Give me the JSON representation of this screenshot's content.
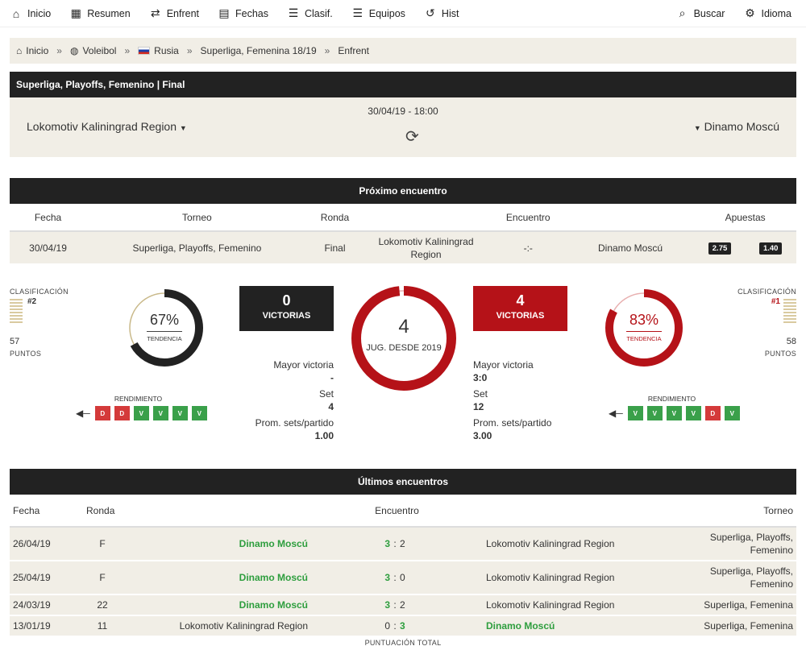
{
  "nav": {
    "items": [
      {
        "icon": "home-icon",
        "glyph": "⌂",
        "label": "Inicio"
      },
      {
        "icon": "dashboard-icon",
        "glyph": "▦",
        "label": "Resumen"
      },
      {
        "icon": "versus-icon",
        "glyph": "⇄",
        "label": "Enfrent"
      },
      {
        "icon": "calendar-icon",
        "glyph": "▤",
        "label": "Fechas"
      },
      {
        "icon": "list-icon",
        "glyph": "☰",
        "label": "Clasif."
      },
      {
        "icon": "list-icon",
        "glyph": "☰",
        "label": "Equipos"
      },
      {
        "icon": "history-icon",
        "glyph": "↺",
        "label": "Hist"
      }
    ],
    "search": "Buscar",
    "language": "Idioma"
  },
  "breadcrumb": [
    "Inicio",
    "Voleibol",
    "Rusia",
    "Superliga, Femenina 18/19",
    "Enfrent"
  ],
  "match": {
    "header": "Superliga, Playoffs, Femenino | Final",
    "datetime": "30/04/19 - 18:00",
    "home": "Lokomotiv Kaliningrad Region",
    "away": "Dinamo Moscú"
  },
  "next": {
    "title": "Próximo encuentro",
    "cols": [
      "Fecha",
      "Torneo",
      "Ronda",
      "Encuentro",
      "Apuestas"
    ],
    "row": {
      "date": "30/04/19",
      "tournament": "Superliga, Playoffs, Femenino",
      "round": "Final",
      "home": "Lokomotiv Kaliningrad Region",
      "score": "-:-",
      "away": "Dinamo Moscú",
      "odd1": "2.75",
      "odd2": "1.40"
    }
  },
  "stats": {
    "clas_label": "CLASIFICACIÓN",
    "points_label": "PUNTOS",
    "home": {
      "rank": "#2",
      "points": "57",
      "pct": "67%",
      "pct_value": 0.67,
      "wins": "0",
      "mayor": "-",
      "sets": "4",
      "prom": "1.00",
      "form": [
        "D",
        "D",
        "V",
        "V",
        "V",
        "V"
      ]
    },
    "away": {
      "rank": "#1",
      "points": "58",
      "pct": "83%",
      "pct_value": 0.83,
      "wins": "4",
      "mayor": "3:0",
      "sets": "12",
      "prom": "3.00",
      "form": [
        "V",
        "V",
        "V",
        "V",
        "D",
        "V"
      ]
    },
    "tendencia": "TENDENCIA",
    "victorias": "VICTORIAS",
    "rendimiento": "RENDIMIENTO",
    "games": "4",
    "games_label": "JUG. DESDE 2019",
    "mayor_label": "Mayor victoria",
    "sets_label": "Set",
    "prom_label": "Prom. sets/partido",
    "colors": {
      "dark": "#222222",
      "red": "#b51218",
      "win": "#3aa04a",
      "loss": "#d43a3a"
    }
  },
  "last": {
    "title": "Últimos encuentros",
    "cols": [
      "Fecha",
      "Ronda",
      "Encuentro",
      "Torneo"
    ],
    "rows": [
      {
        "date": "26/04/19",
        "round": "F",
        "home": "Dinamo Moscú",
        "hs": "3",
        "as": "2",
        "away": "Lokomotiv Kaliningrad Region",
        "tournament": "Superliga, Playoffs, Femenino",
        "homewin": true
      },
      {
        "date": "25/04/19",
        "round": "F",
        "home": "Dinamo Moscú",
        "hs": "3",
        "as": "0",
        "away": "Lokomotiv Kaliningrad Region",
        "tournament": "Superliga, Playoffs, Femenino",
        "homewin": true
      },
      {
        "date": "24/03/19",
        "round": "22",
        "home": "Dinamo Moscú",
        "hs": "3",
        "as": "2",
        "away": "Lokomotiv Kaliningrad Region",
        "tournament": "Superliga, Femenina",
        "homewin": true
      },
      {
        "date": "13/01/19",
        "round": "11",
        "home": "Lokomotiv Kaliningrad Region",
        "hs": "0",
        "as": "3",
        "away": "Dinamo Moscú",
        "tournament": "Superliga, Femenina",
        "homewin": false
      }
    ],
    "footer": "PUNTUACIÓN TOTAL"
  }
}
